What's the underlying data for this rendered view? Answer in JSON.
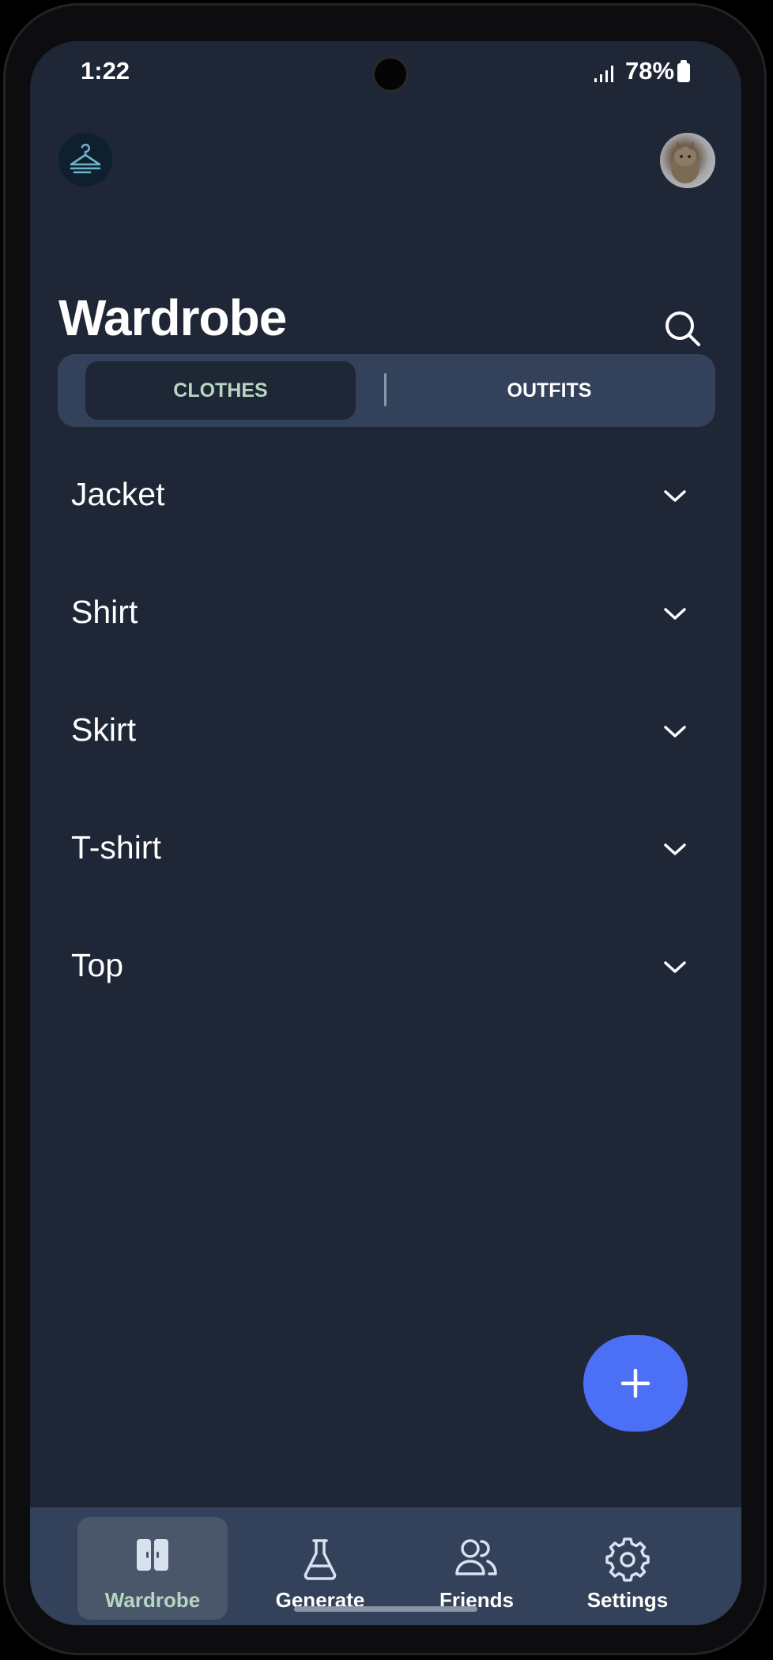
{
  "status_bar": {
    "time": "1:22",
    "battery": "78%"
  },
  "header": {
    "title": "Wardrobe"
  },
  "tabs": [
    {
      "label": "CLOTHES",
      "active": true
    },
    {
      "label": "OUTFITS",
      "active": false
    }
  ],
  "categories": [
    "Jacket",
    "Shirt",
    "Skirt",
    "T-shirt",
    "Top"
  ],
  "bottom_nav": [
    {
      "label": "Wardrobe",
      "icon": "wardrobe-icon",
      "active": true
    },
    {
      "label": "Generate",
      "icon": "flask-icon",
      "active": false
    },
    {
      "label": "Friends",
      "icon": "friends-icon",
      "active": false
    },
    {
      "label": "Settings",
      "icon": "gear-icon",
      "active": false
    }
  ],
  "colors": {
    "background": "#1f2737",
    "surface": "#33425a",
    "accent": "#4b6ff5",
    "active_text": "#b8d5c3"
  }
}
